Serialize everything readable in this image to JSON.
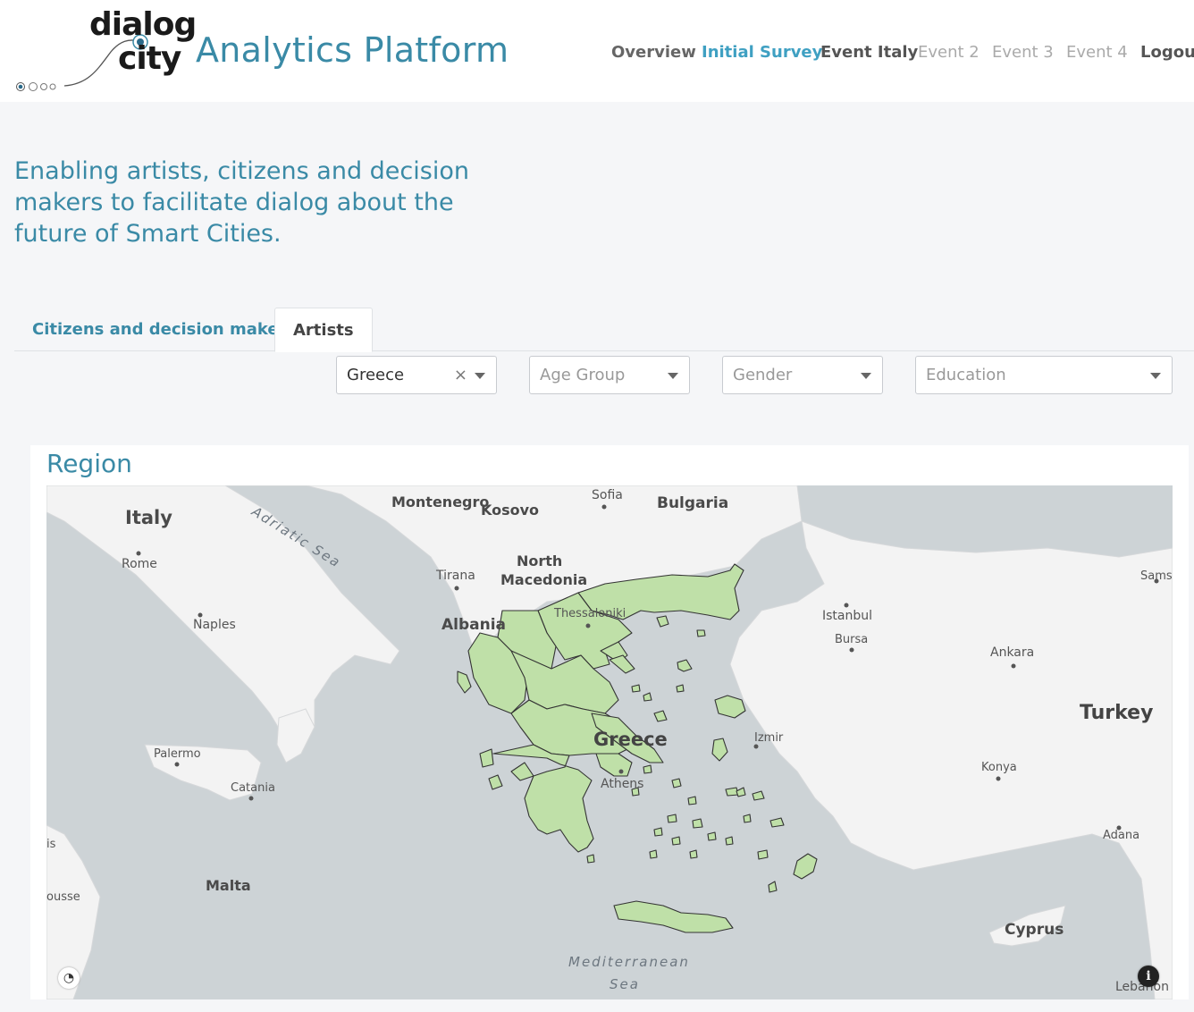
{
  "header": {
    "logo_line1": "dialog",
    "logo_line2": "city",
    "title": "Analytics Platform"
  },
  "nav": {
    "items": [
      {
        "label": "Overview",
        "color": "#666666",
        "state": "normal"
      },
      {
        "label": "Initial Survey",
        "color": "#3fa0c2",
        "state": "active"
      },
      {
        "label": "Event Italy",
        "color": "#555555",
        "state": "normal"
      },
      {
        "label": "Event 2",
        "color": "#aaaaaa",
        "state": "disabled"
      },
      {
        "label": "Event 3",
        "color": "#aaaaaa",
        "state": "disabled"
      },
      {
        "label": "Event 4",
        "color": "#aaaaaa",
        "state": "disabled"
      },
      {
        "label": "Logout",
        "color": "#555555",
        "state": "normal"
      }
    ]
  },
  "tagline": "Enabling artists, citizens and decision makers  to facilitate dialog about the future of Smart Cities.",
  "tabs": [
    {
      "label": "Citizens and decision makers",
      "active": false
    },
    {
      "label": "Artists",
      "active": true
    }
  ],
  "filters": [
    {
      "value": "Greece",
      "placeholder": "",
      "clearable": true
    },
    {
      "value": "",
      "placeholder": "Age Group",
      "clearable": false
    },
    {
      "value": "",
      "placeholder": "Gender",
      "clearable": false
    },
    {
      "value": "",
      "placeholder": "Education",
      "clearable": false
    }
  ],
  "region_panel": {
    "title": "Region",
    "map": {
      "highlight_color": "#bfe0a8",
      "land_color": "#f3f3f3",
      "sea_color": "#cdd3d6",
      "labels": {
        "italy": "Italy",
        "rome": "Rome",
        "naples": "Naples",
        "palermo": "Palermo",
        "catania": "Catania",
        "malta": "Malta",
        "is": "is",
        "sousse": "ousse",
        "adriatic": "Adriatic Sea",
        "montenegro": "Montenegro",
        "kosovo": "Kosovo",
        "sofia": "Sofia",
        "bulgaria": "Bulgaria",
        "tirana": "Tirana",
        "north_macedonia_1": "North",
        "north_macedonia_2": "Macedonia",
        "albania": "Albania",
        "thessaloniki": "Thessaloniki",
        "istanbul": "Istanbul",
        "bursa": "Bursa",
        "ankara": "Ankara",
        "samsun": "Sams",
        "turkey": "Turkey",
        "izmir": "Izmir",
        "konya": "Konya",
        "adana": "Adana",
        "greece": "Greece",
        "athens": "Athens",
        "cyprus": "Cyprus",
        "lebanon": "Lebanon",
        "med_sea_1": "Mediterranean",
        "med_sea_2": "Sea"
      },
      "info_icon": "info-icon",
      "attribution_icon": "mapbox-logo-icon"
    }
  }
}
